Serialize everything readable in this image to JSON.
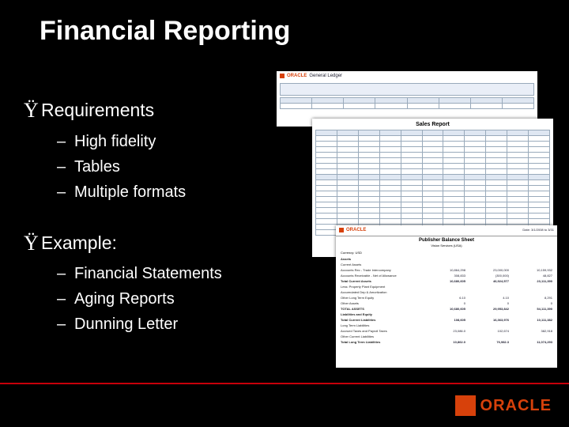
{
  "title": "Financial Reporting",
  "list": {
    "requirements": {
      "label": "Requirements",
      "items": [
        "High fidelity",
        "Tables",
        "Multiple formats"
      ]
    },
    "example": {
      "label": "Example:",
      "items": [
        "Financial Statements",
        "Aging Reports",
        "Dunning Letter"
      ]
    }
  },
  "brand": "ORACLE",
  "docs": {
    "d1_app": "General Ledger",
    "d2_title": "Sales Report",
    "d3_title": "Publisher Balance Sheet",
    "d3_sub": "Vision Services (USA)",
    "d3_date": "Date: 3/1/2008 to 3/31",
    "d3_currency": "Currency: USD",
    "d3_rows": [
      {
        "label": "Assets",
        "c1": "",
        "c2": "",
        "c3": ""
      },
      {
        "label": "Current Assets",
        "c1": "",
        "c2": "",
        "c3": ""
      },
      {
        "label": "Accounts Rec - Trade Intercompany",
        "c1": "10,864,298",
        "c2": "23,000,000",
        "c3": "10,159,932"
      },
      {
        "label": "Accounts Receivable - Net of Allowance",
        "c1": "308,833",
        "c2": "(300,000)",
        "c3": "48,827"
      },
      {
        "label": "Total Current Assets",
        "c1": "10,680,605",
        "c2": "46,924,577",
        "c3": "23,111,390"
      },
      {
        "label": "Less: Property Plant Equipment",
        "c1": "",
        "c2": "",
        "c3": ""
      },
      {
        "label": "Accumulated Dep & Amortization",
        "c1": "",
        "c2": "",
        "c3": ""
      },
      {
        "label": "Other Long Term Equity",
        "c1": "6.10",
        "c2": "4.10",
        "c3": "8,291"
      },
      {
        "label": "Other Assets",
        "c1": "0",
        "c2": "0",
        "c3": "0"
      },
      {
        "label": "TOTAL ASSETS",
        "c1": "10,680,605",
        "c2": "29,953,842",
        "c3": "54,111,390"
      },
      {
        "label": "Liabilities and Equity",
        "c1": "",
        "c2": "",
        "c3": ""
      },
      {
        "label": "Total Current Liabilities",
        "c1": "108,605",
        "c2": "16,363,976",
        "c3": "10,111,382"
      },
      {
        "label": "Long Term Liabilities",
        "c1": "",
        "c2": "",
        "c3": ""
      },
      {
        "label": "Accrued Taxes and Payroll Taxes",
        "c1": "23,086.0",
        "c2": "102,674",
        "c3": "382,918"
      },
      {
        "label": "Other Current Liabilities",
        "c1": "",
        "c2": "",
        "c3": ""
      },
      {
        "label": "Total Long Term Liabilities",
        "c1": "10,862.0",
        "c2": "76,982.3",
        "c3": "11,074,293"
      }
    ]
  }
}
